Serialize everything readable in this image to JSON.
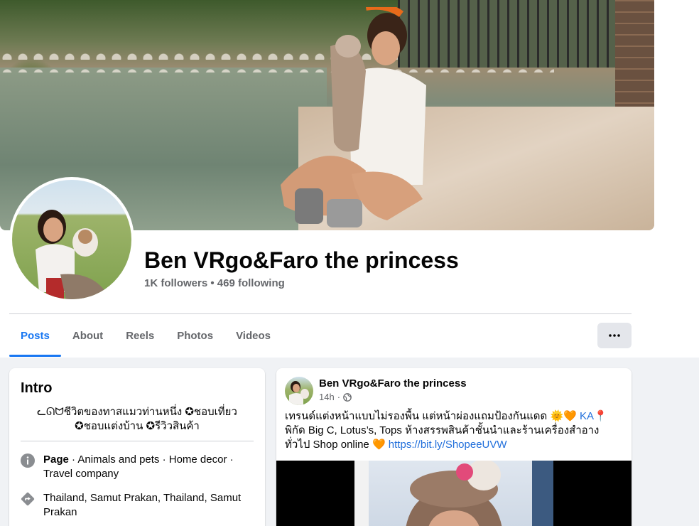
{
  "profile": {
    "name": "Ben VRgo&Faro the princess",
    "followers": "1K followers",
    "separator": " • ",
    "following": "469 following"
  },
  "tabs": [
    "Posts",
    "About",
    "Reels",
    "Photos",
    "Videos"
  ],
  "active_tab": "Posts",
  "more_button_icon": "more-horizontal-icon",
  "intro": {
    "title": "Intro",
    "bio_line1": "ᓚᘏᗢชีวิตของทาสแมวท่านหนึ่ง ✪ชอบเที่ยว",
    "bio_line2": "✪ชอบแต่งบ้าน ✪รีวิวสินค้า",
    "page_label": "Page",
    "page_categories": " · Animals and pets · Home decor · Travel company",
    "location": "Thailand, Samut Prakan, Thailand, Samut Prakan"
  },
  "post": {
    "author": "Ben VRgo&Faro the princess",
    "time": "14h",
    "dot": " · ",
    "text_part1": "เทรนด์แต่งหน้าแบบไม่รองพื้น แต่หน้าผ่องแถมป้องกันแดด 🌞🧡 ",
    "text_ka": "KA",
    "text_part2": "📍พิกัด Big C, Lotus’s, Tops ห้างสรรพสินค้าชั้นนำและร้านเครื่องสำอางทั่วไป  Shop online 🧡 ",
    "link": "https://bit.ly/ShopeeUVW"
  },
  "colors": {
    "accent": "#1877f2",
    "secondary_text": "#65676b",
    "background": "#f0f2f5",
    "link": "#216fdb"
  },
  "icons": {
    "post_privacy": "globe-icon",
    "intro_page": "info-icon",
    "intro_location": "location-diamond-icon"
  }
}
